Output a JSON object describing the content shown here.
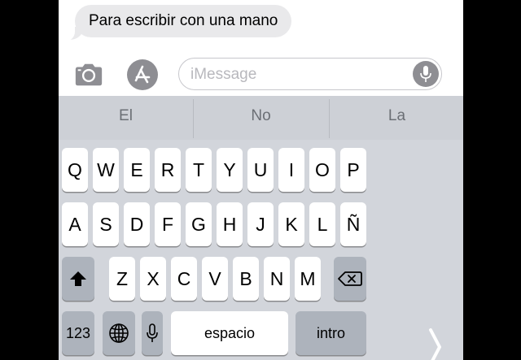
{
  "thread": {
    "received_message": "Para escribir con una mano"
  },
  "input_bar": {
    "camera_icon": "camera-icon",
    "appstore_icon": "appstore-icon",
    "placeholder": "iMessage",
    "dictation_icon": "microphone-icon"
  },
  "keyboard": {
    "suggestions": [
      "El",
      "No",
      "La"
    ],
    "rows": [
      [
        "Q",
        "W",
        "E",
        "R",
        "T",
        "Y",
        "U",
        "I",
        "O",
        "P"
      ],
      [
        "A",
        "S",
        "D",
        "F",
        "G",
        "H",
        "J",
        "K",
        "L",
        "Ñ"
      ],
      [
        "Z",
        "X",
        "C",
        "V",
        "B",
        "N",
        "M"
      ]
    ],
    "numbers_key": "123",
    "space_key": "espacio",
    "return_key": "intro",
    "icons": {
      "shift": "shift-arrow-icon",
      "delete": "backspace-icon",
      "globe": "globe-icon",
      "mic": "microphone-icon",
      "handedness": "chevron-right-icon"
    }
  },
  "colors": {
    "keyboard_background": "#d2d5db",
    "key_face": "#ffffff",
    "function_key": "#adb3bc",
    "icon_gray": "#8e8e93",
    "bubble": "#e9e9eb"
  }
}
